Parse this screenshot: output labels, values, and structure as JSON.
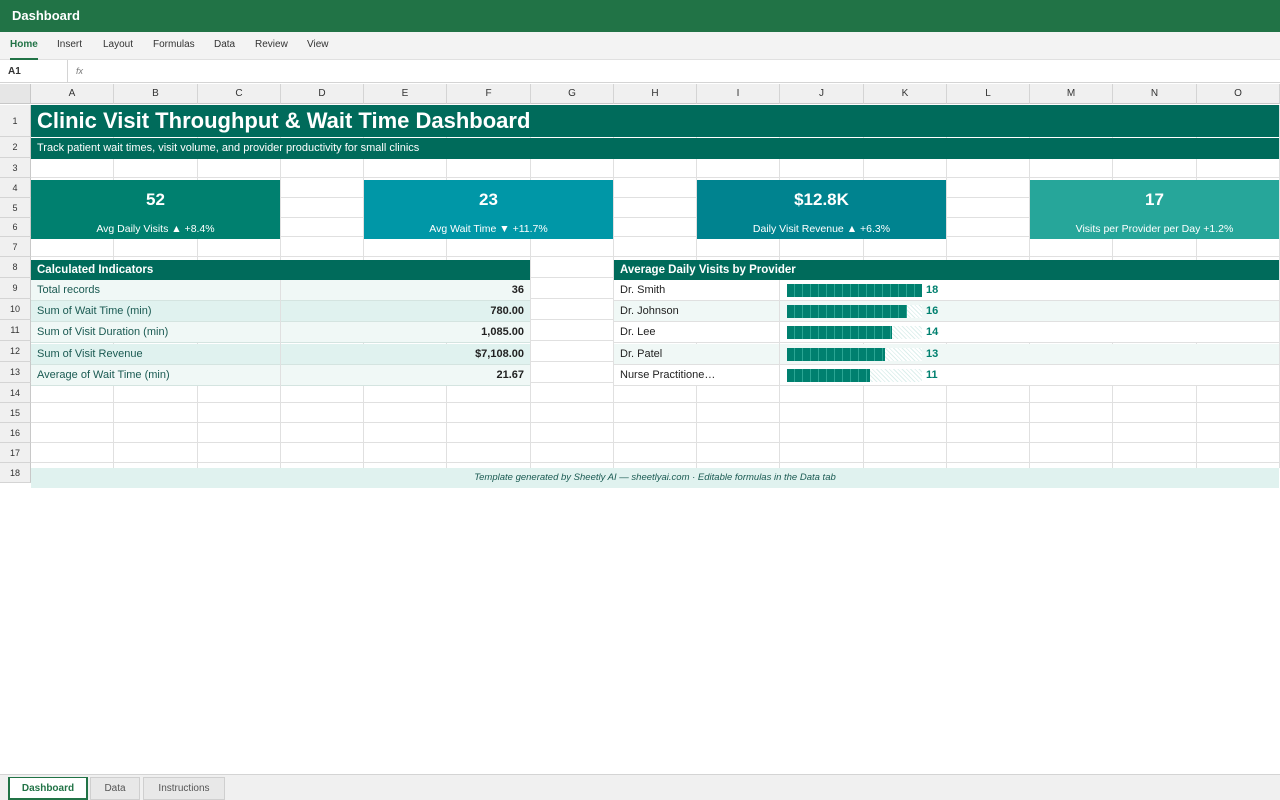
{
  "window": {
    "title": "Dashboard"
  },
  "ribbon": {
    "tabs": [
      "Home",
      "Insert",
      "Layout",
      "Formulas",
      "Data",
      "Review",
      "View"
    ],
    "active": "Home"
  },
  "formula_bar": {
    "cell_ref": "A1",
    "fx_label": "fx",
    "value": ""
  },
  "columns": [
    "A",
    "B",
    "C",
    "D",
    "E",
    "F",
    "G",
    "H",
    "I",
    "J",
    "K",
    "L",
    "M",
    "N",
    "O"
  ],
  "rows": [
    "1",
    "2",
    "3",
    "4",
    "5",
    "6",
    "7",
    "8",
    "9",
    "10",
    "11",
    "12",
    "13",
    "14",
    "15",
    "16",
    "17",
    "18"
  ],
  "dashboard": {
    "title": "Clinic Visit Throughput & Wait Time Dashboard",
    "subtitle": "Track patient wait times, visit volume, and provider productivity for small clinics",
    "kpis": [
      {
        "value": "52",
        "label": "Avg Daily Visits ▲ +8.4%",
        "color": "#00806f"
      },
      {
        "value": "23",
        "label": "Avg Wait Time ▼ +11.7%",
        "color": "#0097a7"
      },
      {
        "value": "$12.8K",
        "label": "Daily Visit Revenue ▲ +6.3%",
        "color": "#00838f"
      },
      {
        "value": "17",
        "label": "Visits per Provider per Day +1.2%",
        "color": "#26a69a"
      }
    ],
    "indicators": {
      "header": "Calculated Indicators",
      "rows": [
        {
          "label": "Total records",
          "value": "36"
        },
        {
          "label": "Sum of Wait Time (min)",
          "value": "780.00"
        },
        {
          "label": "Sum of Visit Duration (min)",
          "value": "1,085.00"
        },
        {
          "label": "Sum of Visit Revenue",
          "value": "$7,108.00"
        },
        {
          "label": "Average of Wait Time (min)",
          "value": "21.67"
        }
      ]
    },
    "provider_chart": {
      "header": "Average Daily Visits by Provider",
      "max": 18,
      "rows": [
        {
          "name": "Dr. Smith",
          "value": 18
        },
        {
          "name": "Dr. Johnson",
          "value": 16
        },
        {
          "name": "Dr. Lee",
          "value": 14
        },
        {
          "name": "Dr. Patel",
          "value": 13
        },
        {
          "name": "Nurse Practitione…",
          "value": 11
        }
      ]
    },
    "footer": "Template generated by Sheetly AI — sheetlyai.com · Editable formulas in the Data tab"
  },
  "sheet_tabs": {
    "tabs": [
      "Dashboard",
      "Data",
      "Instructions"
    ],
    "active": "Dashboard"
  },
  "colors": {
    "brand": "#217346",
    "title_band": "#006b5b",
    "bar": "#00806f"
  }
}
